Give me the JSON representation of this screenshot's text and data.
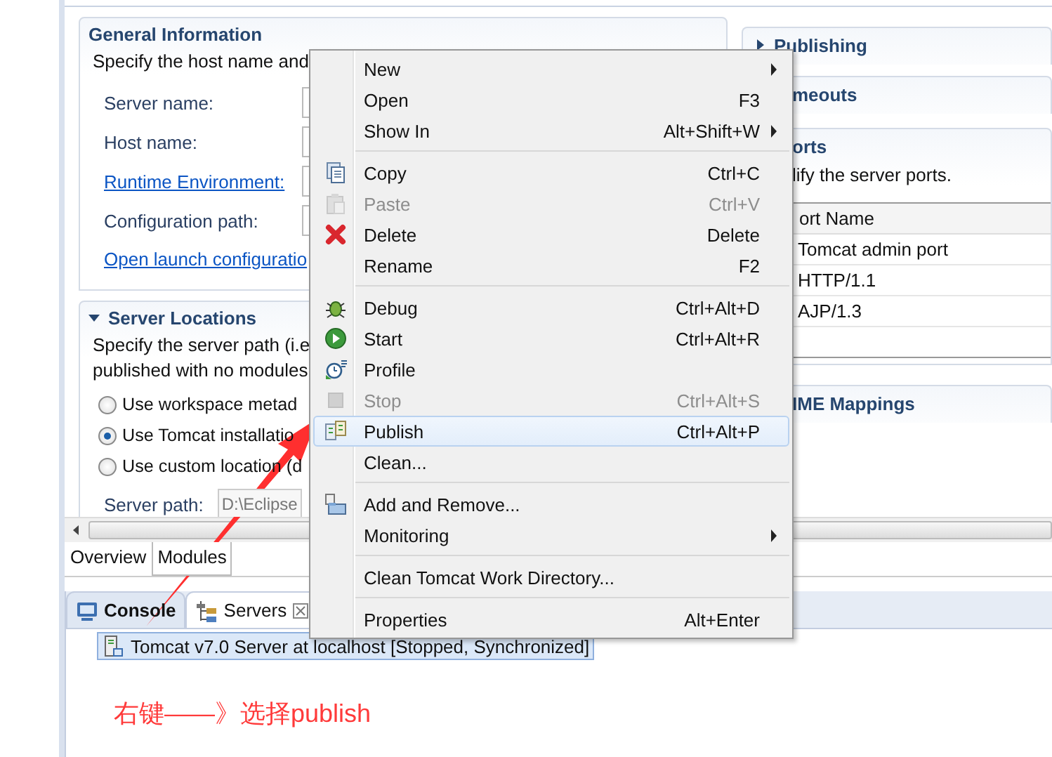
{
  "editor": {
    "general_information": {
      "title": "General Information",
      "description": "Specify the host name and",
      "fields": [
        {
          "label": "Server name:",
          "kind": "text"
        },
        {
          "label": "Host name:",
          "kind": "text"
        },
        {
          "label": "Runtime Environment:",
          "kind": "link"
        },
        {
          "label": "Configuration path:",
          "kind": "text"
        }
      ],
      "link": "Open launch configuratio"
    },
    "server_locations": {
      "title": "Server Locations",
      "expanded": true,
      "description": [
        "Specify the server path (i.e",
        "published with no modules"
      ],
      "options": [
        {
          "label": "Use workspace metad",
          "selected": false
        },
        {
          "label": "Use Tomcat installatio",
          "selected": true
        },
        {
          "label": "Use custom location (d",
          "selected": false
        }
      ],
      "server_path": {
        "label": "Server path:",
        "value": "D:\\Eclipse"
      }
    },
    "right_sections": [
      {
        "title": "Publishing",
        "expanded": false
      },
      {
        "title": "meouts"
      },
      {
        "title": "orts",
        "description": "lify the server ports.",
        "table": {
          "columns": [
            "ort Name"
          ],
          "rows": [
            "Tomcat admin port",
            "HTTP/1.1",
            "AJP/1.3"
          ]
        }
      },
      {
        "title": "IME Mappings"
      }
    ],
    "page_tabs": [
      {
        "label": "Overview",
        "selected": false
      },
      {
        "label": "Modules",
        "selected": true
      }
    ]
  },
  "bottom_panel": {
    "tabs": [
      {
        "label": "Console",
        "selected": false,
        "closable": false
      },
      {
        "label": "Servers",
        "selected": true,
        "closable": true
      }
    ],
    "servers": [
      {
        "label": "Tomcat v7.0 Server at localhost  [Stopped, Synchronized]",
        "selected": true
      }
    ]
  },
  "context_menu": {
    "items": [
      {
        "kind": "item",
        "label": "New",
        "submenu": true,
        "disabled": false,
        "selected": false
      },
      {
        "kind": "item",
        "label": "Open",
        "shortcut": "F3",
        "disabled": false,
        "selected": false
      },
      {
        "kind": "item",
        "label": "Show In",
        "shortcut": "Alt+Shift+W",
        "submenu": true,
        "disabled": false,
        "selected": false
      },
      {
        "kind": "separator"
      },
      {
        "kind": "item",
        "label": "Copy",
        "shortcut": "Ctrl+C",
        "disabled": false,
        "selected": false
      },
      {
        "kind": "item",
        "label": "Paste",
        "shortcut": "Ctrl+V",
        "disabled": true,
        "selected": false
      },
      {
        "kind": "item",
        "label": "Delete",
        "shortcut": "Delete",
        "disabled": false,
        "selected": false
      },
      {
        "kind": "item",
        "label": "Rename",
        "shortcut": "F2",
        "disabled": false,
        "selected": false
      },
      {
        "kind": "separator"
      },
      {
        "kind": "item",
        "label": "Debug",
        "shortcut": "Ctrl+Alt+D",
        "disabled": false,
        "selected": false
      },
      {
        "kind": "item",
        "label": "Start",
        "shortcut": "Ctrl+Alt+R",
        "disabled": false,
        "selected": false
      },
      {
        "kind": "item",
        "label": "Profile",
        "disabled": false,
        "selected": false
      },
      {
        "kind": "item",
        "label": "Stop",
        "shortcut": "Ctrl+Alt+S",
        "disabled": true,
        "selected": false
      },
      {
        "kind": "item",
        "label": "Publish",
        "shortcut": "Ctrl+Alt+P",
        "disabled": false,
        "selected": true
      },
      {
        "kind": "item",
        "label": "Clean...",
        "disabled": false,
        "selected": false
      },
      {
        "kind": "separator"
      },
      {
        "kind": "item",
        "label": "Add and Remove...",
        "disabled": false,
        "selected": false
      },
      {
        "kind": "item",
        "label": "Monitoring",
        "submenu": true,
        "disabled": false,
        "selected": false
      },
      {
        "kind": "separator"
      },
      {
        "kind": "item",
        "label": "Clean Tomcat Work Directory...",
        "disabled": false,
        "selected": false
      },
      {
        "kind": "separator"
      },
      {
        "kind": "item",
        "label": "Properties",
        "shortcut": "Alt+Enter",
        "disabled": false,
        "selected": false
      }
    ]
  },
  "annotation": "右键——》选择publish"
}
